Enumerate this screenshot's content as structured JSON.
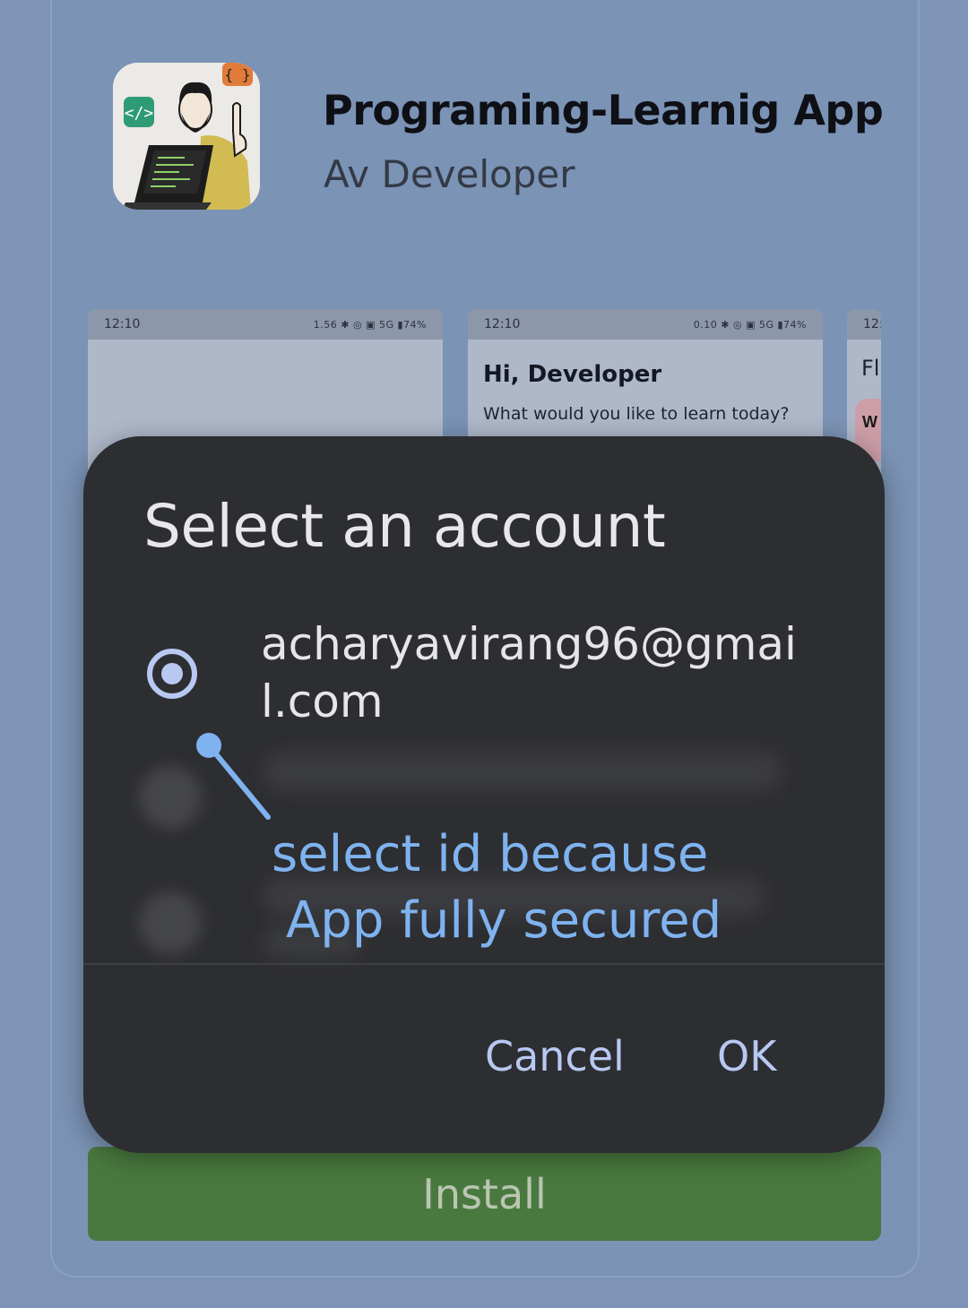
{
  "app": {
    "title": "Programing-Learnig App",
    "developer": "Av Developer",
    "install_label": "Install"
  },
  "screenshots": [
    {
      "time": "12:10",
      "status_right": "1.56 ✱ ◎ ▣ 5G ▮74%"
    },
    {
      "time": "12:10",
      "status_right": "0.10 ✱ ◎ ▣ 5G ▮74%",
      "greeting": "Hi, Developer",
      "subtitle": "What would you like to learn today?"
    },
    {
      "time": "12:",
      "heading": "Fl",
      "card_text": "W u"
    }
  ],
  "dialog": {
    "title": "Select an account",
    "selected_account": "acharyavirang96@gmail.com",
    "cancel_label": "Cancel",
    "ok_label": "OK"
  },
  "annotation": {
    "line1": "select id because",
    "line2": "App fully secured"
  },
  "colors": {
    "overlay": "#7d94b6",
    "dialog_bg": "#2d2e31",
    "accent": "#b8c8f2",
    "annotation": "#7fb3f0",
    "install": "#4a793f"
  }
}
